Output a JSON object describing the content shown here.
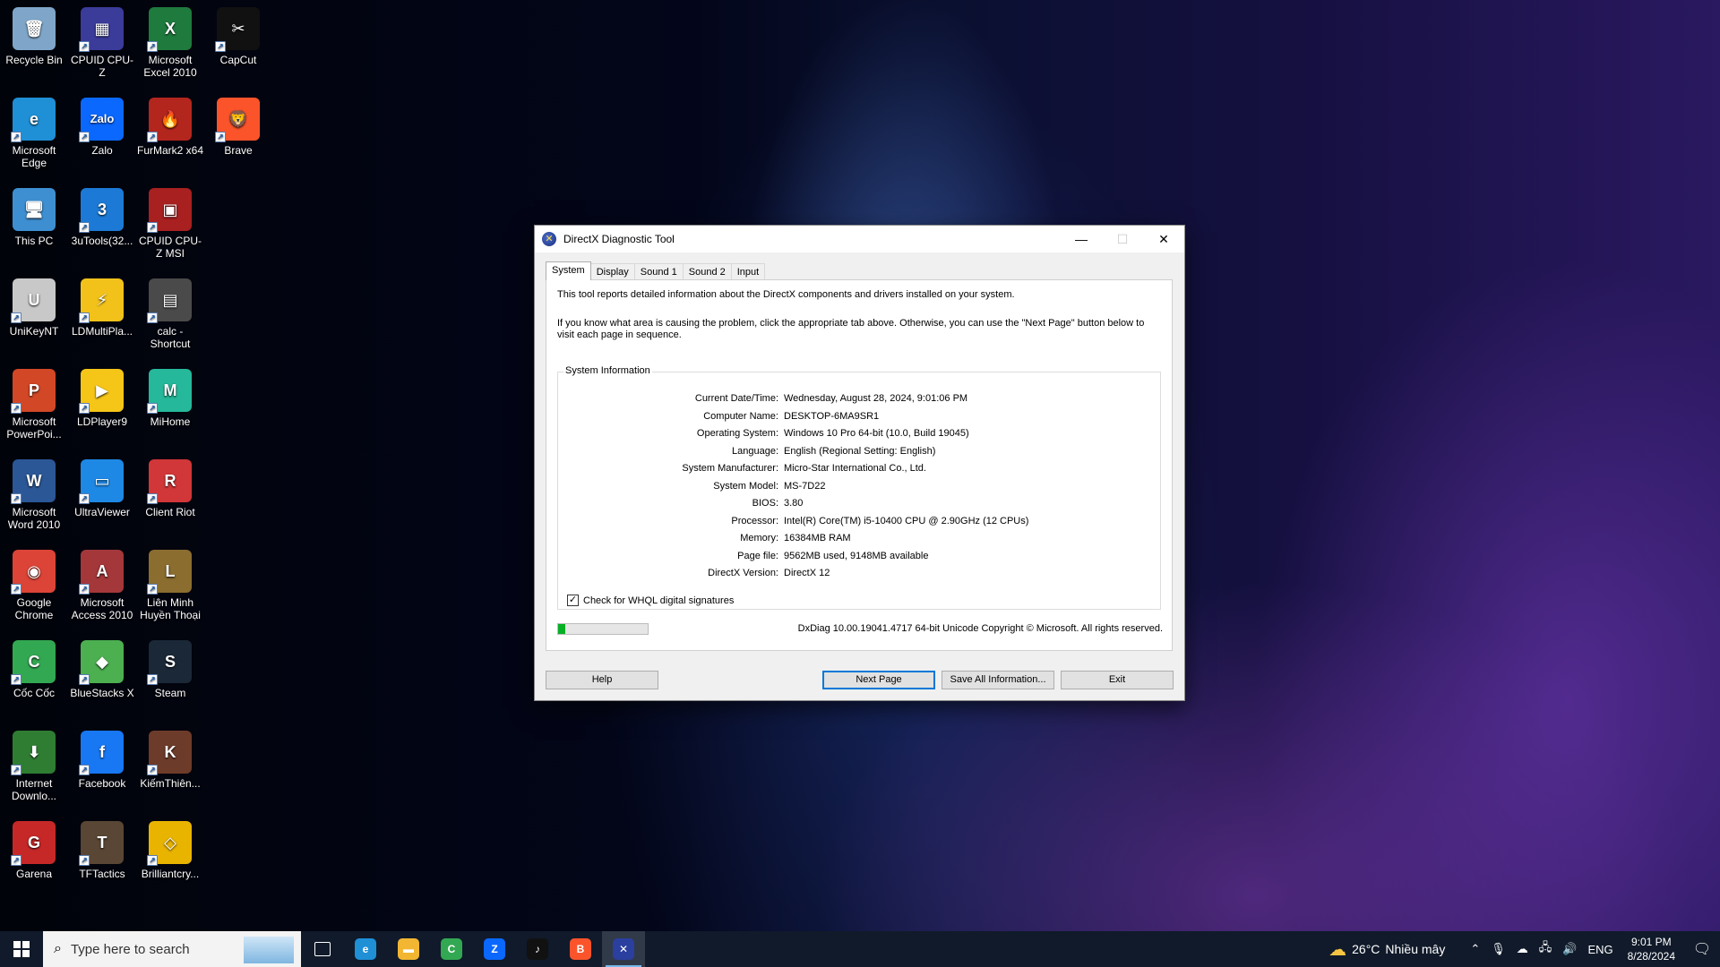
{
  "desktop": {
    "icons": [
      {
        "label": "Recycle Bin",
        "glyph": "🗑",
        "color": "#7fa6c9",
        "icon": "recycle-bin-icon"
      },
      {
        "label": "CPUID CPU-Z",
        "glyph": "▦",
        "color": "#3b3b9a",
        "icon": "cpuz-icon"
      },
      {
        "label": "Microsoft Excel 2010",
        "glyph": "X",
        "color": "#1f7a3d",
        "icon": "excel-icon"
      },
      {
        "label": "CapCut",
        "glyph": "✂",
        "color": "#111111",
        "icon": "capcut-icon"
      },
      {
        "label": "Microsoft Edge",
        "glyph": "e",
        "color": "#1f8fd6",
        "icon": "edge-icon"
      },
      {
        "label": "Zalo",
        "glyph": "Zalo",
        "color": "#0a68ff",
        "icon": "zalo-icon"
      },
      {
        "label": "FurMark2 x64",
        "glyph": "🔥",
        "color": "#b3261e",
        "icon": "furmark-icon"
      },
      {
        "label": "Brave",
        "glyph": "🦁",
        "color": "#fb542b",
        "icon": "brave-icon"
      },
      {
        "label": "This PC",
        "glyph": "🖥",
        "color": "#3d8fd1",
        "icon": "this-pc-icon"
      },
      {
        "label": "3uTools(32...",
        "glyph": "3",
        "color": "#1c7ad6",
        "icon": "3utools-icon"
      },
      {
        "label": "CPUID CPU-Z MSI",
        "glyph": "▣",
        "color": "#a82020",
        "icon": "cpuz-msi-icon"
      },
      {
        "label": "UniKeyNT",
        "glyph": "U",
        "color": "#c8c8c8",
        "icon": "unikey-icon"
      },
      {
        "label": "LDMultiPla...",
        "glyph": "⚡",
        "color": "#f2c21a",
        "icon": "ldmultiplayer-icon"
      },
      {
        "label": "calc - Shortcut",
        "glyph": "▤",
        "color": "#4a4a4a",
        "icon": "calculator-icon"
      },
      {
        "label": "Microsoft PowerPoi...",
        "glyph": "P",
        "color": "#d24726",
        "icon": "powerpoint-icon"
      },
      {
        "label": "LDPlayer9",
        "glyph": "▶",
        "color": "#f5c518",
        "icon": "ldplayer-icon"
      },
      {
        "label": "MiHome",
        "glyph": "M",
        "color": "#25b89a",
        "icon": "mihome-icon"
      },
      {
        "label": "Microsoft Word 2010",
        "glyph": "W",
        "color": "#2b5797",
        "icon": "word-icon"
      },
      {
        "label": "UltraViewer",
        "glyph": "▭",
        "color": "#1e88e5",
        "icon": "ultraviewer-icon"
      },
      {
        "label": "Client Riot",
        "glyph": "R",
        "color": "#d13639",
        "icon": "riot-client-icon"
      },
      {
        "label": "Google Chrome",
        "glyph": "◉",
        "color": "#db4437",
        "icon": "chrome-icon"
      },
      {
        "label": "Microsoft Access 2010",
        "glyph": "A",
        "color": "#a4373a",
        "icon": "access-icon"
      },
      {
        "label": "Liên Minh Huyền Thoại",
        "glyph": "L",
        "color": "#8a6d2f",
        "icon": "league-icon"
      },
      {
        "label": "Cốc Cốc",
        "glyph": "C",
        "color": "#33a852",
        "icon": "coccoc-icon"
      },
      {
        "label": "BlueStacks X",
        "glyph": "◆",
        "color": "#4caf50",
        "icon": "bluestacks-icon"
      },
      {
        "label": "Steam",
        "glyph": "S",
        "color": "#1b2838",
        "icon": "steam-icon"
      },
      {
        "label": "Internet Downlo...",
        "glyph": "⬇",
        "color": "#2e7d32",
        "icon": "idm-icon"
      },
      {
        "label": "Facebook",
        "glyph": "f",
        "color": "#1877f2",
        "icon": "facebook-icon"
      },
      {
        "label": "KiếmThiên...",
        "glyph": "K",
        "color": "#6d3b2a",
        "icon": "kiemthien-icon"
      },
      {
        "label": "Garena",
        "glyph": "G",
        "color": "#c62828",
        "icon": "garena-icon"
      },
      {
        "label": "TFTactics",
        "glyph": "T",
        "color": "#5a4634",
        "icon": "tftactics-icon"
      },
      {
        "label": "Brilliantcry...",
        "glyph": "◇",
        "color": "#e8b400",
        "icon": "brilliantcrystal-icon"
      }
    ]
  },
  "window": {
    "title": "DirectX Diagnostic Tool",
    "tabs": [
      "System",
      "Display",
      "Sound 1",
      "Sound 2",
      "Input"
    ],
    "active_tab": "System",
    "intro1": "This tool reports detailed information about the DirectX components and drivers installed on your system.",
    "intro2": "If you know what area is causing the problem, click the appropriate tab above.  Otherwise, you can use the \"Next Page\" button below to visit each page in sequence.",
    "sysinfo_label": "System Information",
    "rows": [
      {
        "k": "Current Date/Time:",
        "v": "Wednesday, August 28, 2024, 9:01:06 PM"
      },
      {
        "k": "Computer Name:",
        "v": "DESKTOP-6MA9SR1"
      },
      {
        "k": "Operating System:",
        "v": "Windows 10 Pro 64-bit (10.0, Build 19045)"
      },
      {
        "k": "Language:",
        "v": "English (Regional Setting: English)"
      },
      {
        "k": "System Manufacturer:",
        "v": "Micro-Star International Co., Ltd."
      },
      {
        "k": "System Model:",
        "v": "MS-7D22"
      },
      {
        "k": "BIOS:",
        "v": "3.80"
      },
      {
        "k": "Processor:",
        "v": "Intel(R) Core(TM) i5-10400 CPU @ 2.90GHz (12 CPUs)"
      },
      {
        "k": "Memory:",
        "v": "16384MB RAM"
      },
      {
        "k": "Page file:",
        "v": "9562MB used, 9148MB available"
      },
      {
        "k": "DirectX Version:",
        "v": "DirectX 12"
      }
    ],
    "whql_label": "Check for WHQL digital signatures",
    "whql_checked": true,
    "progress_fraction": 0.08,
    "copyright": "DxDiag 10.00.19041.4717 64-bit Unicode  Copyright © Microsoft. All rights reserved.",
    "buttons": {
      "help": "Help",
      "next": "Next Page",
      "save": "Save All Information...",
      "exit": "Exit"
    },
    "controls": {
      "minimize": "—",
      "maximize": "☐",
      "close": "✕"
    }
  },
  "taskbar": {
    "search_placeholder": "Type here to search",
    "apps": [
      {
        "name": "task-view-icon",
        "glyph": "▣",
        "color": "#101a2a"
      },
      {
        "name": "edge-icon",
        "glyph": "e",
        "color": "#1f8fd6"
      },
      {
        "name": "file-explorer-icon",
        "glyph": "▬",
        "color": "#f2b632"
      },
      {
        "name": "coccoc-icon",
        "glyph": "C",
        "color": "#33a852"
      },
      {
        "name": "zalo-icon",
        "glyph": "Z",
        "color": "#0a68ff"
      },
      {
        "name": "tiktok-icon",
        "glyph": "♪",
        "color": "#111111"
      },
      {
        "name": "brave-icon",
        "glyph": "B",
        "color": "#fb542b"
      },
      {
        "name": "dxdiag-icon",
        "glyph": "✕",
        "color": "#2a3f9e"
      }
    ],
    "active_app": "dxdiag-icon",
    "weather_temp": "26°C",
    "weather_text": "Nhiều mây",
    "language": "ENG",
    "time": "9:01 PM",
    "date": "8/28/2024"
  }
}
